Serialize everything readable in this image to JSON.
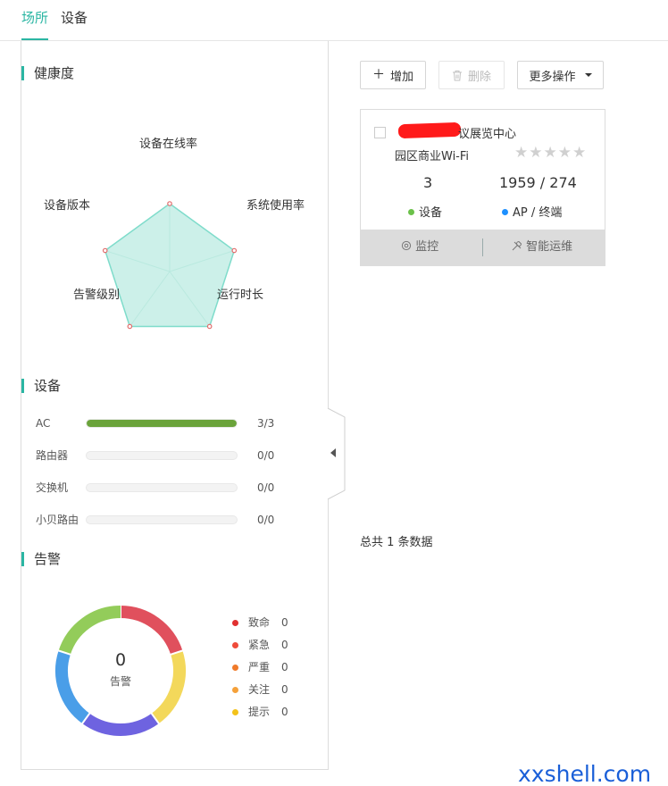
{
  "tabs": [
    {
      "label": "场所",
      "active": true
    },
    {
      "label": "设备",
      "active": false
    }
  ],
  "health": {
    "title": "健康度",
    "axes": [
      "设备在线率",
      "系统使用率",
      "运行时长",
      "告警级别",
      "设备版本"
    ],
    "values": [
      1,
      1,
      1,
      1,
      1
    ],
    "colors": {
      "line": "#7fdccb",
      "fill": "#e6f7f3",
      "grid": "#cdeee6",
      "point": "#e26b6b"
    }
  },
  "devices": {
    "title": "设备",
    "rows": [
      {
        "name": "AC",
        "count": "3/3",
        "fraction": 1
      },
      {
        "name": "路由器",
        "count": "0/0",
        "fraction": 0
      },
      {
        "name": "交换机",
        "count": "0/0",
        "fraction": 0
      },
      {
        "name": "小贝路由",
        "count": "0/0",
        "fraction": 0
      }
    ],
    "bar_color": "#6aa33a"
  },
  "alarms": {
    "title": "告警",
    "total": "0",
    "total_label": "告警",
    "ring_colors": [
      "#e0505d",
      "#f3d85b",
      "#6e63e0",
      "#4a9ee8",
      "#93cc5a"
    ],
    "legend": [
      {
        "label": "致命",
        "value": "0",
        "color": "#e03030"
      },
      {
        "label": "紧急",
        "value": "0",
        "color": "#ef4b3a"
      },
      {
        "label": "严重",
        "value": "0",
        "color": "#f07a2a"
      },
      {
        "label": "关注",
        "value": "0",
        "color": "#f5a13a"
      },
      {
        "label": "提示",
        "value": "0",
        "color": "#f3c21a"
      }
    ]
  },
  "toolbar": {
    "add_label": "增加",
    "add_icon": "plus-icon",
    "delete_label": "删除",
    "delete_icon": "trash-icon",
    "more_label": "更多操作",
    "more_icon": "caret-down-icon"
  },
  "card": {
    "name_visible": "议展览中心",
    "type": "园区商业Wi-Fi",
    "stars": "★★★★★",
    "device_count": "3",
    "ap_terminal_count": "1959 / 274",
    "device_label": "设备",
    "device_dot_color": "#6bc14a",
    "ap_label": "AP / 终端",
    "ap_dot_color": "#1e90ff",
    "monitor_label": "监控",
    "monitor_icon": "gear-icon",
    "ops_label": "智能运维",
    "ops_icon": "tools-icon"
  },
  "footer": {
    "total_text": "总共 1 条数据"
  },
  "watermark": "xxshell.com"
}
